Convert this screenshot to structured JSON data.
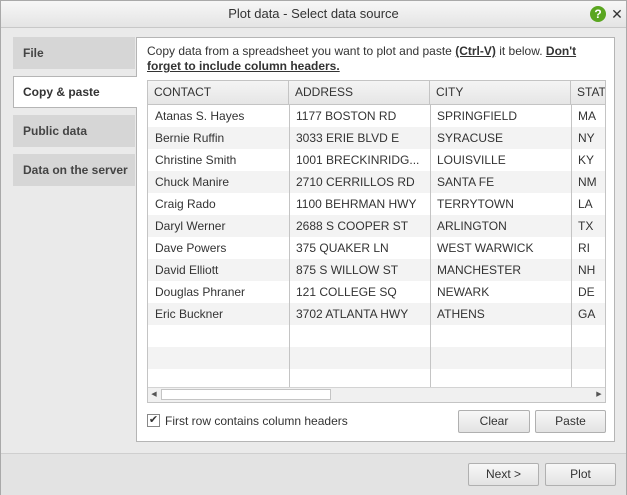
{
  "window": {
    "title": "Plot data - Select data source",
    "help_symbol": "?",
    "close_symbol": "✕"
  },
  "tabs": [
    {
      "label": "File",
      "active": false
    },
    {
      "label": "Copy & paste",
      "active": true
    },
    {
      "label": "Public data",
      "active": false
    },
    {
      "label": "Data on the server",
      "active": false
    }
  ],
  "instructions": {
    "text_start": "Copy data from a spreadsheet you want to plot and paste ",
    "shortcut": "(Ctrl-V)",
    "text_mid": " it below. ",
    "warning": "Don't forget to include column headers."
  },
  "grid": {
    "headers": [
      "CONTACT",
      "ADDRESS",
      "CITY",
      "STAT"
    ],
    "rows": [
      [
        "Atanas S. Hayes",
        "1177 BOSTON RD",
        "SPRINGFIELD",
        "MA"
      ],
      [
        "Bernie Ruffin",
        "3033 ERIE BLVD E",
        "SYRACUSE",
        "NY"
      ],
      [
        "Christine Smith",
        "1001 BRECKINRIDG...",
        "LOUISVILLE",
        "KY"
      ],
      [
        "Chuck Manire",
        "2710 CERRILLOS RD",
        "SANTA FE",
        "NM"
      ],
      [
        "Craig Rado",
        "1100 BEHRMAN HWY",
        "TERRYTOWN",
        "LA"
      ],
      [
        "Daryl Werner",
        "2688 S COOPER ST",
        "ARLINGTON",
        "TX"
      ],
      [
        "Dave Powers",
        "375 QUAKER LN",
        "WEST WARWICK",
        "RI"
      ],
      [
        "David Elliott",
        "875 S WILLOW ST",
        "MANCHESTER",
        "NH"
      ],
      [
        "Douglas Phraner",
        "121 COLLEGE SQ",
        "NEWARK",
        "DE"
      ],
      [
        "Eric Buckner",
        "3702 ATLANTA HWY",
        "ATHENS",
        "GA"
      ]
    ],
    "scroll_left": "◀",
    "scroll_right": "▶"
  },
  "options": {
    "first_row_headers_label": "First row contains column headers",
    "first_row_headers_checked": true,
    "check_mark": "✔"
  },
  "buttons": {
    "clear": "Clear",
    "paste": "Paste",
    "next": "Next >",
    "plot": "Plot"
  },
  "colors": {
    "help_badge": "#5aa620",
    "active_tab": "#ffffff",
    "inactive_tab": "#d6d6d6"
  }
}
